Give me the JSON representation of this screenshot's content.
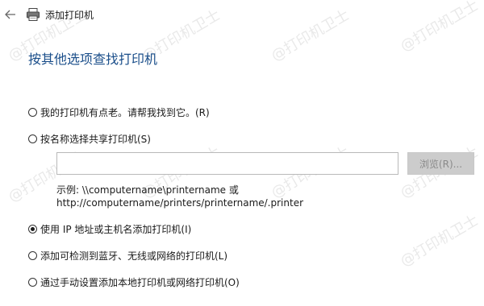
{
  "window": {
    "title": "添加打印机"
  },
  "page": {
    "heading": "按其他选项查找打印机",
    "options": [
      {
        "label": "我的打印机有点老。请帮我找到它。(R)",
        "checked": false
      },
      {
        "label": "按名称选择共享打印机(S)",
        "checked": false
      },
      {
        "label": "使用 IP 地址或主机名添加打印机(I)",
        "checked": true
      },
      {
        "label": "添加可检测到蓝牙、无线或网络的打印机(L)",
        "checked": false
      },
      {
        "label": "通过手动设置添加本地打印机或网络打印机(O)",
        "checked": false
      }
    ],
    "shared_printer_input": {
      "value": "",
      "placeholder": ""
    },
    "browse_button": "浏览(R)...",
    "example_line1": "示例: \\\\computername\\printername 或",
    "example_line2": "http://computername/printers/printername/.printer"
  },
  "watermark": {
    "text": "@打印机卫士"
  },
  "colors": {
    "heading": "#1a4e8a",
    "disabled_button_bg": "#cccccc"
  }
}
